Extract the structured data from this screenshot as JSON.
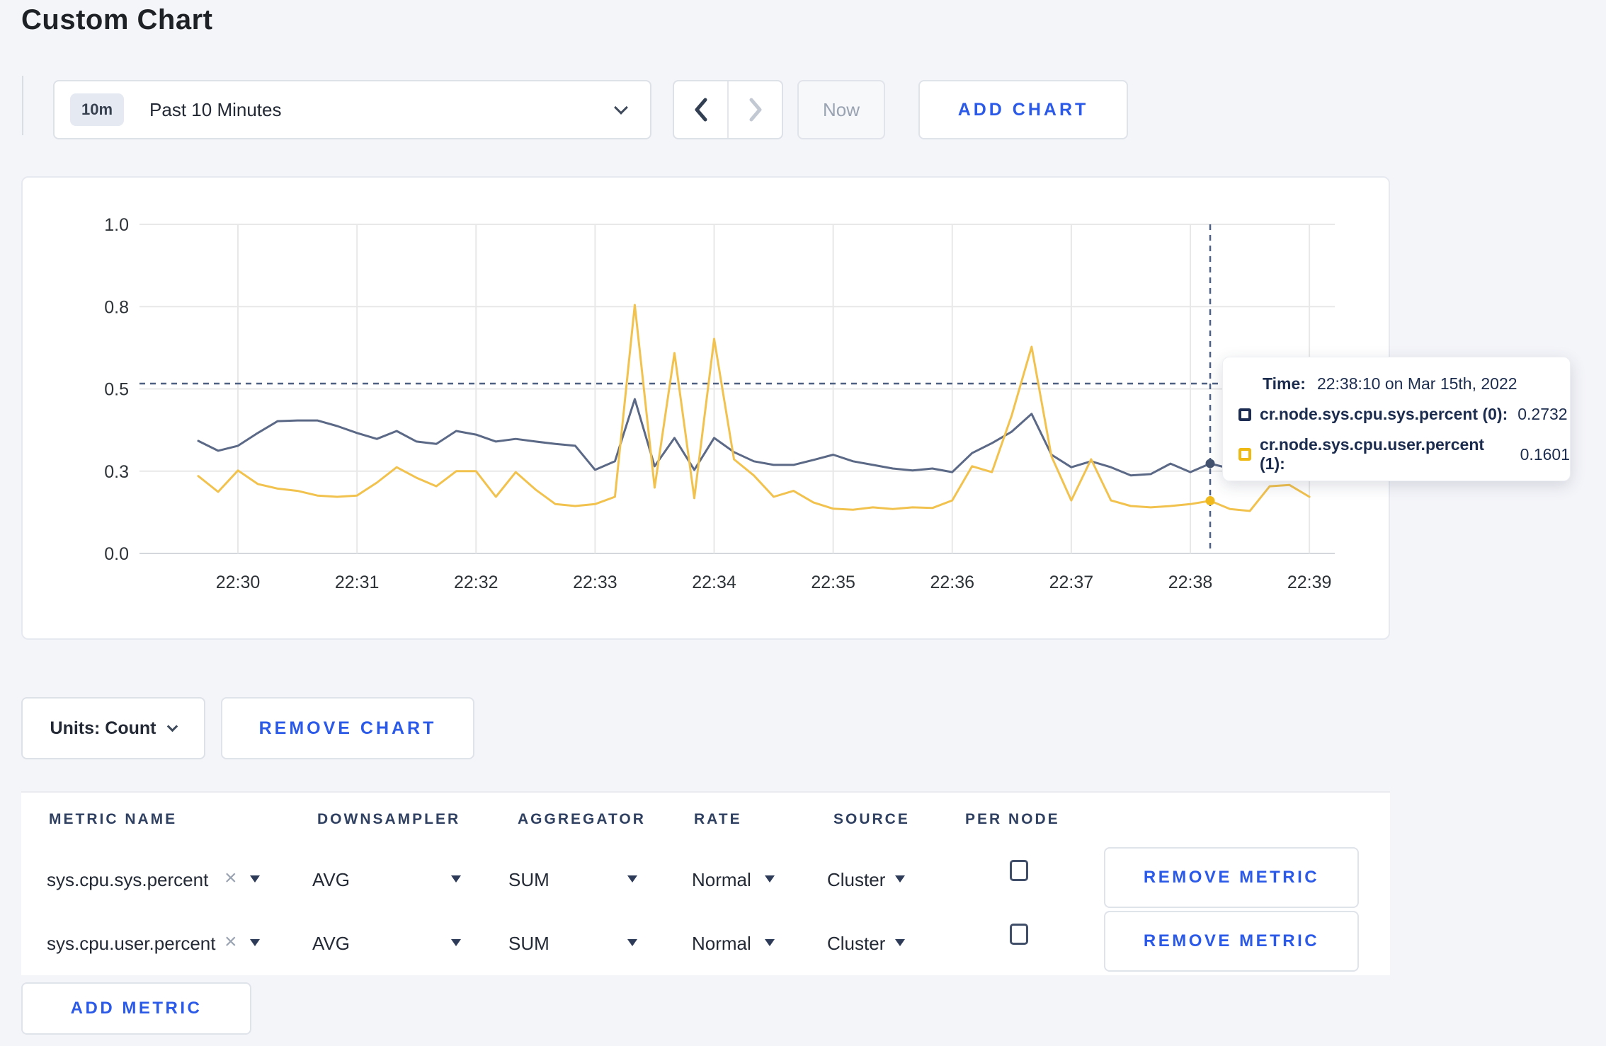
{
  "page": {
    "title": "Custom Chart"
  },
  "toolbar": {
    "range_badge": "10m",
    "range_label": "Past 10 Minutes",
    "now_label": "Now",
    "add_chart_label": "ADD CHART"
  },
  "tooltip": {
    "time_label": "Time:",
    "time_value": "22:38:10 on Mar 15th, 2022",
    "series": [
      {
        "name": "cr.node.sys.cpu.sys.percent (0):",
        "value": "0.2732",
        "swatch_color": "#1c2c52"
      },
      {
        "name": "cr.node.sys.cpu.user.percent (1):",
        "value": "0.1601",
        "swatch_color": "#eeb912"
      }
    ]
  },
  "chart_data": {
    "type": "line",
    "title": "",
    "xlabel": "",
    "ylabel": "",
    "ylim": [
      0,
      1
    ],
    "grid": true,
    "start_time": "22:29:40",
    "interval_seconds": 10,
    "y_ticks": [
      {
        "label": "0.0",
        "value": 0
      },
      {
        "label": "0.3",
        "value": 0.25
      },
      {
        "label": "0.5",
        "value": 0.5
      },
      {
        "label": "0.8",
        "value": 0.75
      },
      {
        "label": "1.0",
        "value": 1
      }
    ],
    "x_ticks": [
      {
        "label": "22:30",
        "index": 2
      },
      {
        "label": "22:31",
        "index": 8
      },
      {
        "label": "22:32",
        "index": 14
      },
      {
        "label": "22:33",
        "index": 20
      },
      {
        "label": "22:34",
        "index": 26
      },
      {
        "label": "22:35",
        "index": 32
      },
      {
        "label": "22:36",
        "index": 38
      },
      {
        "label": "22:37",
        "index": 44
      },
      {
        "label": "22:38",
        "index": 50
      },
      {
        "label": "22:39",
        "index": 56
      }
    ],
    "series": [
      {
        "name": "cr.node.sys.cpu.sys.percent",
        "color": "#5b6987",
        "dot_color": "#42526f",
        "values": [
          0.342,
          0.312,
          0.327,
          0.366,
          0.402,
          0.404,
          0.404,
          0.387,
          0.366,
          0.348,
          0.372,
          0.34,
          0.333,
          0.372,
          0.361,
          0.34,
          0.348,
          0.34,
          0.333,
          0.327,
          0.254,
          0.28,
          0.469,
          0.265,
          0.351,
          0.254,
          0.351,
          0.308,
          0.28,
          0.269,
          0.269,
          0.284,
          0.3,
          0.28,
          0.269,
          0.258,
          0.252,
          0.258,
          0.247,
          0.305,
          0.335,
          0.37,
          0.424,
          0.3,
          0.262,
          0.28,
          0.262,
          0.237,
          0.241,
          0.273,
          0.247,
          0.2732,
          0.258,
          0.262,
          0.27,
          0.268,
          0.272
        ]
      },
      {
        "name": "cr.node.sys.cpu.user.percent",
        "color": "#f2c24e",
        "dot_color": "#f1ba1c",
        "values": [
          0.235,
          0.187,
          0.252,
          0.211,
          0.197,
          0.19,
          0.176,
          0.172,
          0.176,
          0.215,
          0.262,
          0.23,
          0.204,
          0.25,
          0.25,
          0.172,
          0.247,
          0.194,
          0.15,
          0.144,
          0.15,
          0.172,
          0.755,
          0.2,
          0.609,
          0.168,
          0.652,
          0.286,
          0.237,
          0.172,
          0.19,
          0.155,
          0.136,
          0.133,
          0.14,
          0.135,
          0.14,
          0.138,
          0.161,
          0.265,
          0.247,
          0.42,
          0.628,
          0.295,
          0.161,
          0.286,
          0.161,
          0.144,
          0.14,
          0.144,
          0.15,
          0.1601,
          0.135,
          0.129,
          0.204,
          0.208,
          0.172
        ]
      }
    ],
    "crosshair": {
      "index": 51,
      "time": "22:38:10",
      "hline_value": 0.516,
      "color": "#4e6183"
    },
    "legend_position": "none"
  },
  "chart_controls": {
    "units_label": "Units: Count",
    "remove_chart_label": "REMOVE CHART"
  },
  "metrics_table": {
    "headers": [
      "METRIC NAME",
      "DOWNSAMPLER",
      "AGGREGATOR",
      "RATE",
      "SOURCE",
      "PER NODE"
    ],
    "rows": [
      {
        "metric": "sys.cpu.sys.percent",
        "remove_token": "×",
        "downsampler": "AVG",
        "aggregator": "SUM",
        "rate": "Normal",
        "source": "Cluster",
        "per_node_checked": false,
        "remove_label": "REMOVE METRIC"
      },
      {
        "metric": "sys.cpu.user.percent",
        "remove_token": "×",
        "downsampler": "AVG",
        "aggregator": "SUM",
        "rate": "Normal",
        "source": "Cluster",
        "per_node_checked": false,
        "remove_label": "REMOVE METRIC"
      }
    ],
    "add_metric_label": "ADD METRIC"
  },
  "colors": {
    "accent_blue": "#2b59e8",
    "page_background": "#f4f5f9",
    "grid_line": "#e8e8e8"
  }
}
